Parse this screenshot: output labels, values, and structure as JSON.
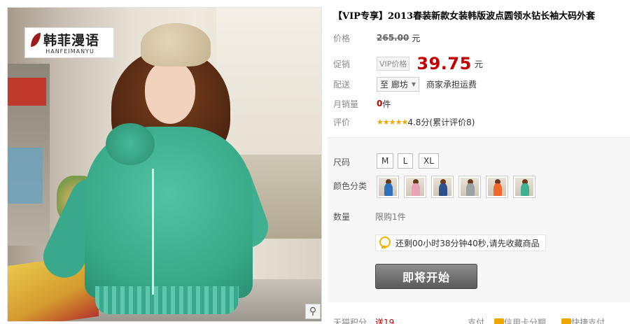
{
  "product": {
    "title": "【VIP专享】2013春装新款女装韩版波点圆领水钻长袖大码外套"
  },
  "brand": {
    "name_cn": "韩菲漫语",
    "name_en": "HANFEIMANYU"
  },
  "image": {
    "zoom_icon": "magnifier-icon"
  },
  "price": {
    "label": "价格",
    "original": "265.00",
    "unit": "元"
  },
  "promo": {
    "label": "促销",
    "tag": "VIP价格",
    "price": "39.75",
    "unit": "元"
  },
  "delivery": {
    "label": "配送",
    "destination": "至 廊坊",
    "freight": "商家承担运费"
  },
  "monthly_sales": {
    "label": "月销量",
    "count": "0",
    "unit": "件"
  },
  "rating": {
    "label": "评价",
    "stars": "★★★★★",
    "text": "4.8分(累计评价8)"
  },
  "size": {
    "label": "尺码",
    "options": [
      "M",
      "L",
      "XL"
    ]
  },
  "color": {
    "label": "颜色分类",
    "swatches": [
      "#2f6fc0",
      "#e9a3b5",
      "#2d4f8e",
      "#9aa2a8",
      "#ef6a2a",
      "#3fb092"
    ]
  },
  "quantity": {
    "label": "数量",
    "limit": "限购1件"
  },
  "countdown": {
    "icon": "lightbulb-icon",
    "text": "还剩00小时38分钟40秒,请先收藏商品"
  },
  "buy_button": {
    "label": "即将开始"
  },
  "footer": {
    "points_label": "天猫积分",
    "points_value": "送19",
    "pay_label": "支付",
    "credit": "信用卡分期",
    "express": "快捷支付"
  }
}
